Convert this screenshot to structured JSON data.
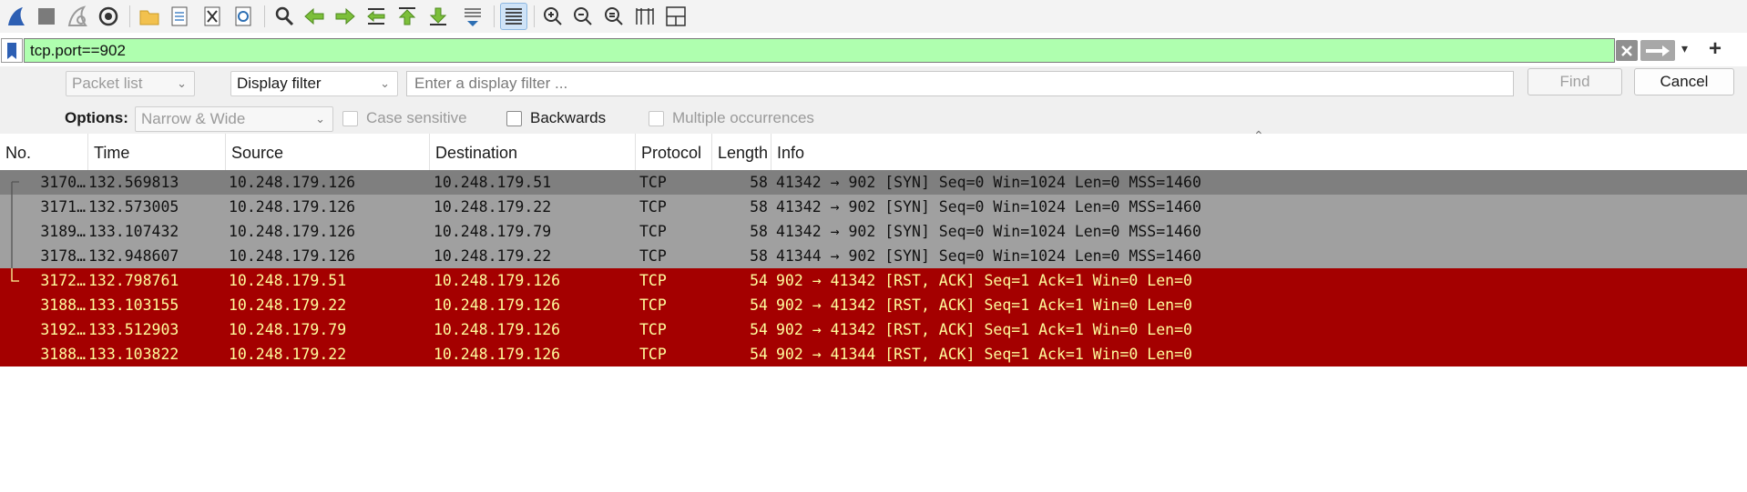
{
  "toolbar": {
    "buttons": [
      "shark-fin-start-icon",
      "stop-square-icon",
      "restart-fin-icon",
      "capture-options-gear-icon",
      "open-folder-icon",
      "save-file-icon",
      "close-file-icon",
      "reload-icon",
      "find-packet-icon",
      "go-back-arrow-icon",
      "go-forward-arrow-icon",
      "go-to-packet-icon",
      "go-first-packet-icon",
      "go-last-packet-icon",
      "auto-scroll-icon",
      "colorize-list-icon",
      "zoom-in-icon",
      "zoom-out-icon",
      "zoom-normal-icon",
      "resize-columns-icon",
      "layout-panes-icon"
    ]
  },
  "filter": {
    "value": "tcp.port==902",
    "field_color": "#afffaf"
  },
  "find": {
    "search_in": "Packet list",
    "search_type": "Display filter",
    "input_placeholder": "Enter a display filter ...",
    "find_label": "Find",
    "cancel_label": "Cancel",
    "options_label": "Options:",
    "char_width": "Narrow & Wide",
    "case_sensitive": "Case sensitive",
    "backwards": "Backwards",
    "multiple": "Multiple occurrences"
  },
  "columns": [
    "No.",
    "Time",
    "Source",
    "Destination",
    "Protocol",
    "Length",
    "Info"
  ],
  "colors": {
    "selected_bg": "#7f7f7f",
    "syn_bg": "#a0a0a0",
    "rst_bg": "#a40000",
    "rst_fg": "#fffc9c"
  },
  "packets": [
    {
      "no": "3170…",
      "time": "132.569813",
      "src": "10.248.179.126",
      "dst": "10.248.179.51",
      "proto": "TCP",
      "len": "58",
      "info": "41342 → 902 [SYN] Seq=0 Win=1024 Len=0 MSS=1460",
      "kind": "selected"
    },
    {
      "no": "3171…",
      "time": "132.573005",
      "src": "10.248.179.126",
      "dst": "10.248.179.22",
      "proto": "TCP",
      "len": "58",
      "info": "41342 → 902 [SYN] Seq=0 Win=1024 Len=0 MSS=1460",
      "kind": "syn"
    },
    {
      "no": "3189…",
      "time": "133.107432",
      "src": "10.248.179.126",
      "dst": "10.248.179.79",
      "proto": "TCP",
      "len": "58",
      "info": "41342 → 902 [SYN] Seq=0 Win=1024 Len=0 MSS=1460",
      "kind": "syn"
    },
    {
      "no": "3178…",
      "time": "132.948607",
      "src": "10.248.179.126",
      "dst": "10.248.179.22",
      "proto": "TCP",
      "len": "58",
      "info": "41344 → 902 [SYN] Seq=0 Win=1024 Len=0 MSS=1460",
      "kind": "syn"
    },
    {
      "no": "3172…",
      "time": "132.798761",
      "src": "10.248.179.51",
      "dst": "10.248.179.126",
      "proto": "TCP",
      "len": "54",
      "info": "902 → 41342 [RST, ACK] Seq=1 Ack=1 Win=0 Len=0",
      "kind": "rst"
    },
    {
      "no": "3188…",
      "time": "133.103155",
      "src": "10.248.179.22",
      "dst": "10.248.179.126",
      "proto": "TCP",
      "len": "54",
      "info": "902 → 41342 [RST, ACK] Seq=1 Ack=1 Win=0 Len=0",
      "kind": "rst"
    },
    {
      "no": "3192…",
      "time": "133.512903",
      "src": "10.248.179.79",
      "dst": "10.248.179.126",
      "proto": "TCP",
      "len": "54",
      "info": "902 → 41342 [RST, ACK] Seq=1 Ack=1 Win=0 Len=0",
      "kind": "rst"
    },
    {
      "no": "3188…",
      "time": "133.103822",
      "src": "10.248.179.22",
      "dst": "10.248.179.126",
      "proto": "TCP",
      "len": "54",
      "info": "902 → 41344 [RST, ACK] Seq=1 Ack=1 Win=0 Len=0",
      "kind": "rst"
    }
  ]
}
